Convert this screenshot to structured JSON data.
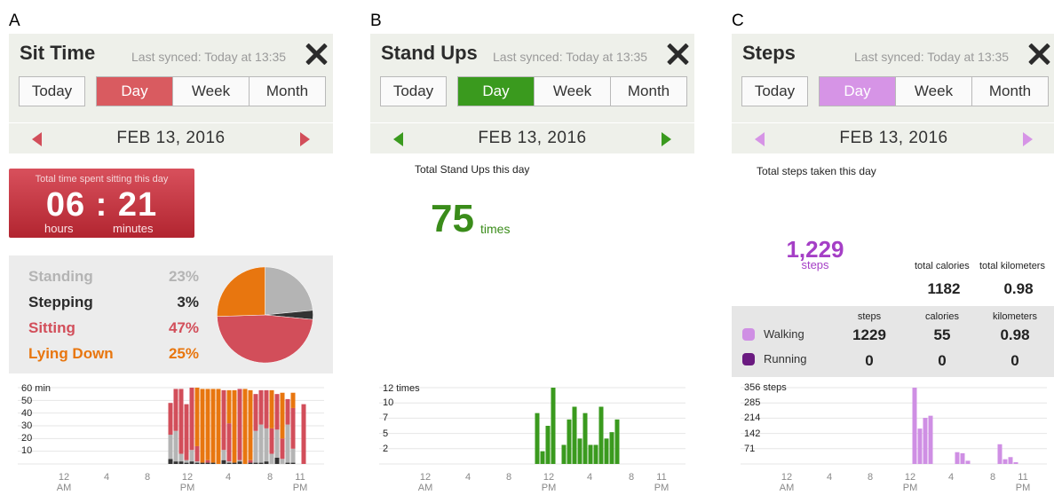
{
  "panels": [
    {
      "letter": "A",
      "title": "Sit Time",
      "synced": "Last synced: Today at 13:35",
      "today_label": "Today",
      "tabs": [
        "Day",
        "Week",
        "Month"
      ],
      "active_tab": "Day",
      "accent": "#d95b60",
      "date": "FEB 13, 2016",
      "summary": {
        "label": "Total time spent sitting this day",
        "time": "06 : 21",
        "hours_unit": "hours",
        "minutes_unit": "minutes"
      },
      "breakdown": [
        {
          "label": "Standing",
          "pct": "23%",
          "color": "#b4b4b4"
        },
        {
          "label": "Stepping",
          "pct": "3%",
          "color": "#333333"
        },
        {
          "label": "Sitting",
          "pct": "47%",
          "color": "#d24e5a"
        },
        {
          "label": "Lying Down",
          "pct": "25%",
          "color": "#e8760f"
        }
      ],
      "chart_y_labels": [
        "60 min",
        "50",
        "40",
        "30",
        "20",
        "10"
      ],
      "chart_x_labels": [
        [
          "12",
          "AM"
        ],
        [
          "4",
          ""
        ],
        [
          "8",
          ""
        ],
        [
          "12",
          "PM"
        ],
        [
          "4",
          ""
        ],
        [
          "8",
          ""
        ],
        [
          "11",
          "PM"
        ]
      ]
    },
    {
      "letter": "B",
      "title": "Stand Ups",
      "synced": "Last synced: Today at 13:35",
      "today_label": "Today",
      "tabs": [
        "Day",
        "Week",
        "Month"
      ],
      "active_tab": "Day",
      "accent": "#3a9a1e",
      "date": "FEB 13, 2016",
      "subhead": "Total Stand Ups this day",
      "count": "75",
      "count_unit": "times",
      "chart_y_labels": [
        "12 times",
        "10",
        "7",
        "5",
        "2"
      ],
      "chart_x_labels": [
        [
          "12",
          "AM"
        ],
        [
          "4",
          ""
        ],
        [
          "8",
          ""
        ],
        [
          "12",
          "PM"
        ],
        [
          "4",
          ""
        ],
        [
          "8",
          ""
        ],
        [
          "11",
          "PM"
        ]
      ]
    },
    {
      "letter": "C",
      "title": "Steps",
      "synced": "Last synced: Today at 13:35",
      "today_label": "Today",
      "tabs": [
        "Day",
        "Week",
        "Month"
      ],
      "active_tab": "Day",
      "accent": "#d694e6",
      "date": "FEB 13, 2016",
      "subhead": "Total steps taken this day",
      "count": "1,229",
      "count_unit": "steps",
      "totals": {
        "calories_label": "total calories",
        "calories": "1182",
        "km_label": "total kilometers",
        "km": "0.98"
      },
      "activity_headers": [
        "steps",
        "calories",
        "kilometers"
      ],
      "activities": [
        {
          "name": "Walking",
          "color": "#cf8fe4",
          "steps": "1229",
          "calories": "55",
          "km": "0.98"
        },
        {
          "name": "Running",
          "color": "#6a1a80",
          "steps": "0",
          "calories": "0",
          "km": "0"
        }
      ],
      "chart_y_labels": [
        "356 steps",
        "285",
        "214",
        "142",
        "71"
      ],
      "chart_x_labels": [
        [
          "12",
          "AM"
        ],
        [
          "4",
          ""
        ],
        [
          "8",
          ""
        ],
        [
          "12",
          "PM"
        ],
        [
          "4",
          ""
        ],
        [
          "8",
          ""
        ],
        [
          "11",
          "PM"
        ]
      ]
    }
  ],
  "chart_data": [
    {
      "type": "bar",
      "title": "Sit Time",
      "ylabel": "min",
      "ylim": [
        0,
        60
      ],
      "x": [
        10,
        10.5,
        11,
        11.5,
        12,
        12.5,
        13,
        13.5,
        14,
        14.5,
        15,
        15.5,
        16,
        16.5,
        17,
        17.5,
        18,
        18.5,
        19,
        19.5,
        20,
        20.5,
        21,
        21.5,
        22,
        22.5
      ],
      "stacked": true,
      "series": [
        {
          "name": "Stepping",
          "color": "#333333",
          "values": [
            4,
            2,
            2,
            1,
            2,
            1,
            1,
            1,
            1,
            0,
            3,
            1,
            1,
            2,
            0,
            1,
            1,
            1,
            2,
            0,
            5,
            0,
            1,
            1,
            0,
            0
          ]
        },
        {
          "name": "Standing",
          "color": "#b4b4b4",
          "values": [
            19,
            24,
            6,
            2,
            9,
            1,
            0,
            0,
            0,
            0,
            8,
            1,
            0,
            1,
            0,
            0,
            25,
            30,
            26,
            8,
            22,
            4,
            30,
            11,
            0,
            0
          ]
        },
        {
          "name": "Sitting",
          "color": "#d24e5a",
          "values": [
            25,
            33,
            51,
            44,
            49,
            12,
            0,
            2,
            0,
            0,
            47,
            30,
            0,
            56,
            0,
            2,
            29,
            27,
            30,
            20,
            28,
            16,
            20,
            32,
            0,
            47
          ]
        },
        {
          "name": "Lying Down",
          "color": "#e8760f",
          "values": [
            0,
            0,
            0,
            0,
            0,
            46,
            58,
            56,
            58,
            59,
            0,
            26,
            57,
            0,
            59,
            55,
            0,
            0,
            0,
            30,
            0,
            36,
            0,
            12,
            0,
            0
          ]
        }
      ]
    },
    {
      "type": "bar",
      "title": "Stand Ups",
      "ylabel": "times",
      "ylim": [
        0,
        12
      ],
      "x": [
        10,
        10.5,
        11,
        11.5,
        12,
        12.5,
        13,
        13.5,
        14,
        14.5,
        15,
        15.5,
        16,
        16.5,
        17,
        17.5,
        18,
        18.5,
        19,
        19.5,
        20,
        20.5,
        21,
        21.5,
        22,
        22.5
      ],
      "series": [
        {
          "name": "Stand Ups",
          "color": "#3a9a1e",
          "values": [
            0,
            8,
            2,
            6,
            12,
            0,
            3,
            7,
            9,
            4,
            8,
            3,
            3,
            9,
            4,
            5,
            7,
            0,
            0,
            0,
            0,
            0,
            0,
            0,
            0,
            0
          ]
        }
      ]
    },
    {
      "type": "bar",
      "title": "Steps",
      "ylabel": "steps",
      "ylim": [
        0,
        356
      ],
      "x": [
        12,
        12.5,
        13,
        13.5,
        14,
        14.5,
        15,
        15.5,
        16,
        16.5,
        17,
        17.5,
        18,
        18.5,
        19,
        19.5,
        20,
        20.5,
        21,
        21.5
      ],
      "series": [
        {
          "name": "Walking",
          "color": "#cf8fe4",
          "values": [
            356,
            165,
            215,
            225,
            0,
            0,
            0,
            0,
            55,
            50,
            15,
            0,
            0,
            0,
            0,
            0,
            92,
            22,
            32,
            8
          ]
        }
      ]
    }
  ]
}
